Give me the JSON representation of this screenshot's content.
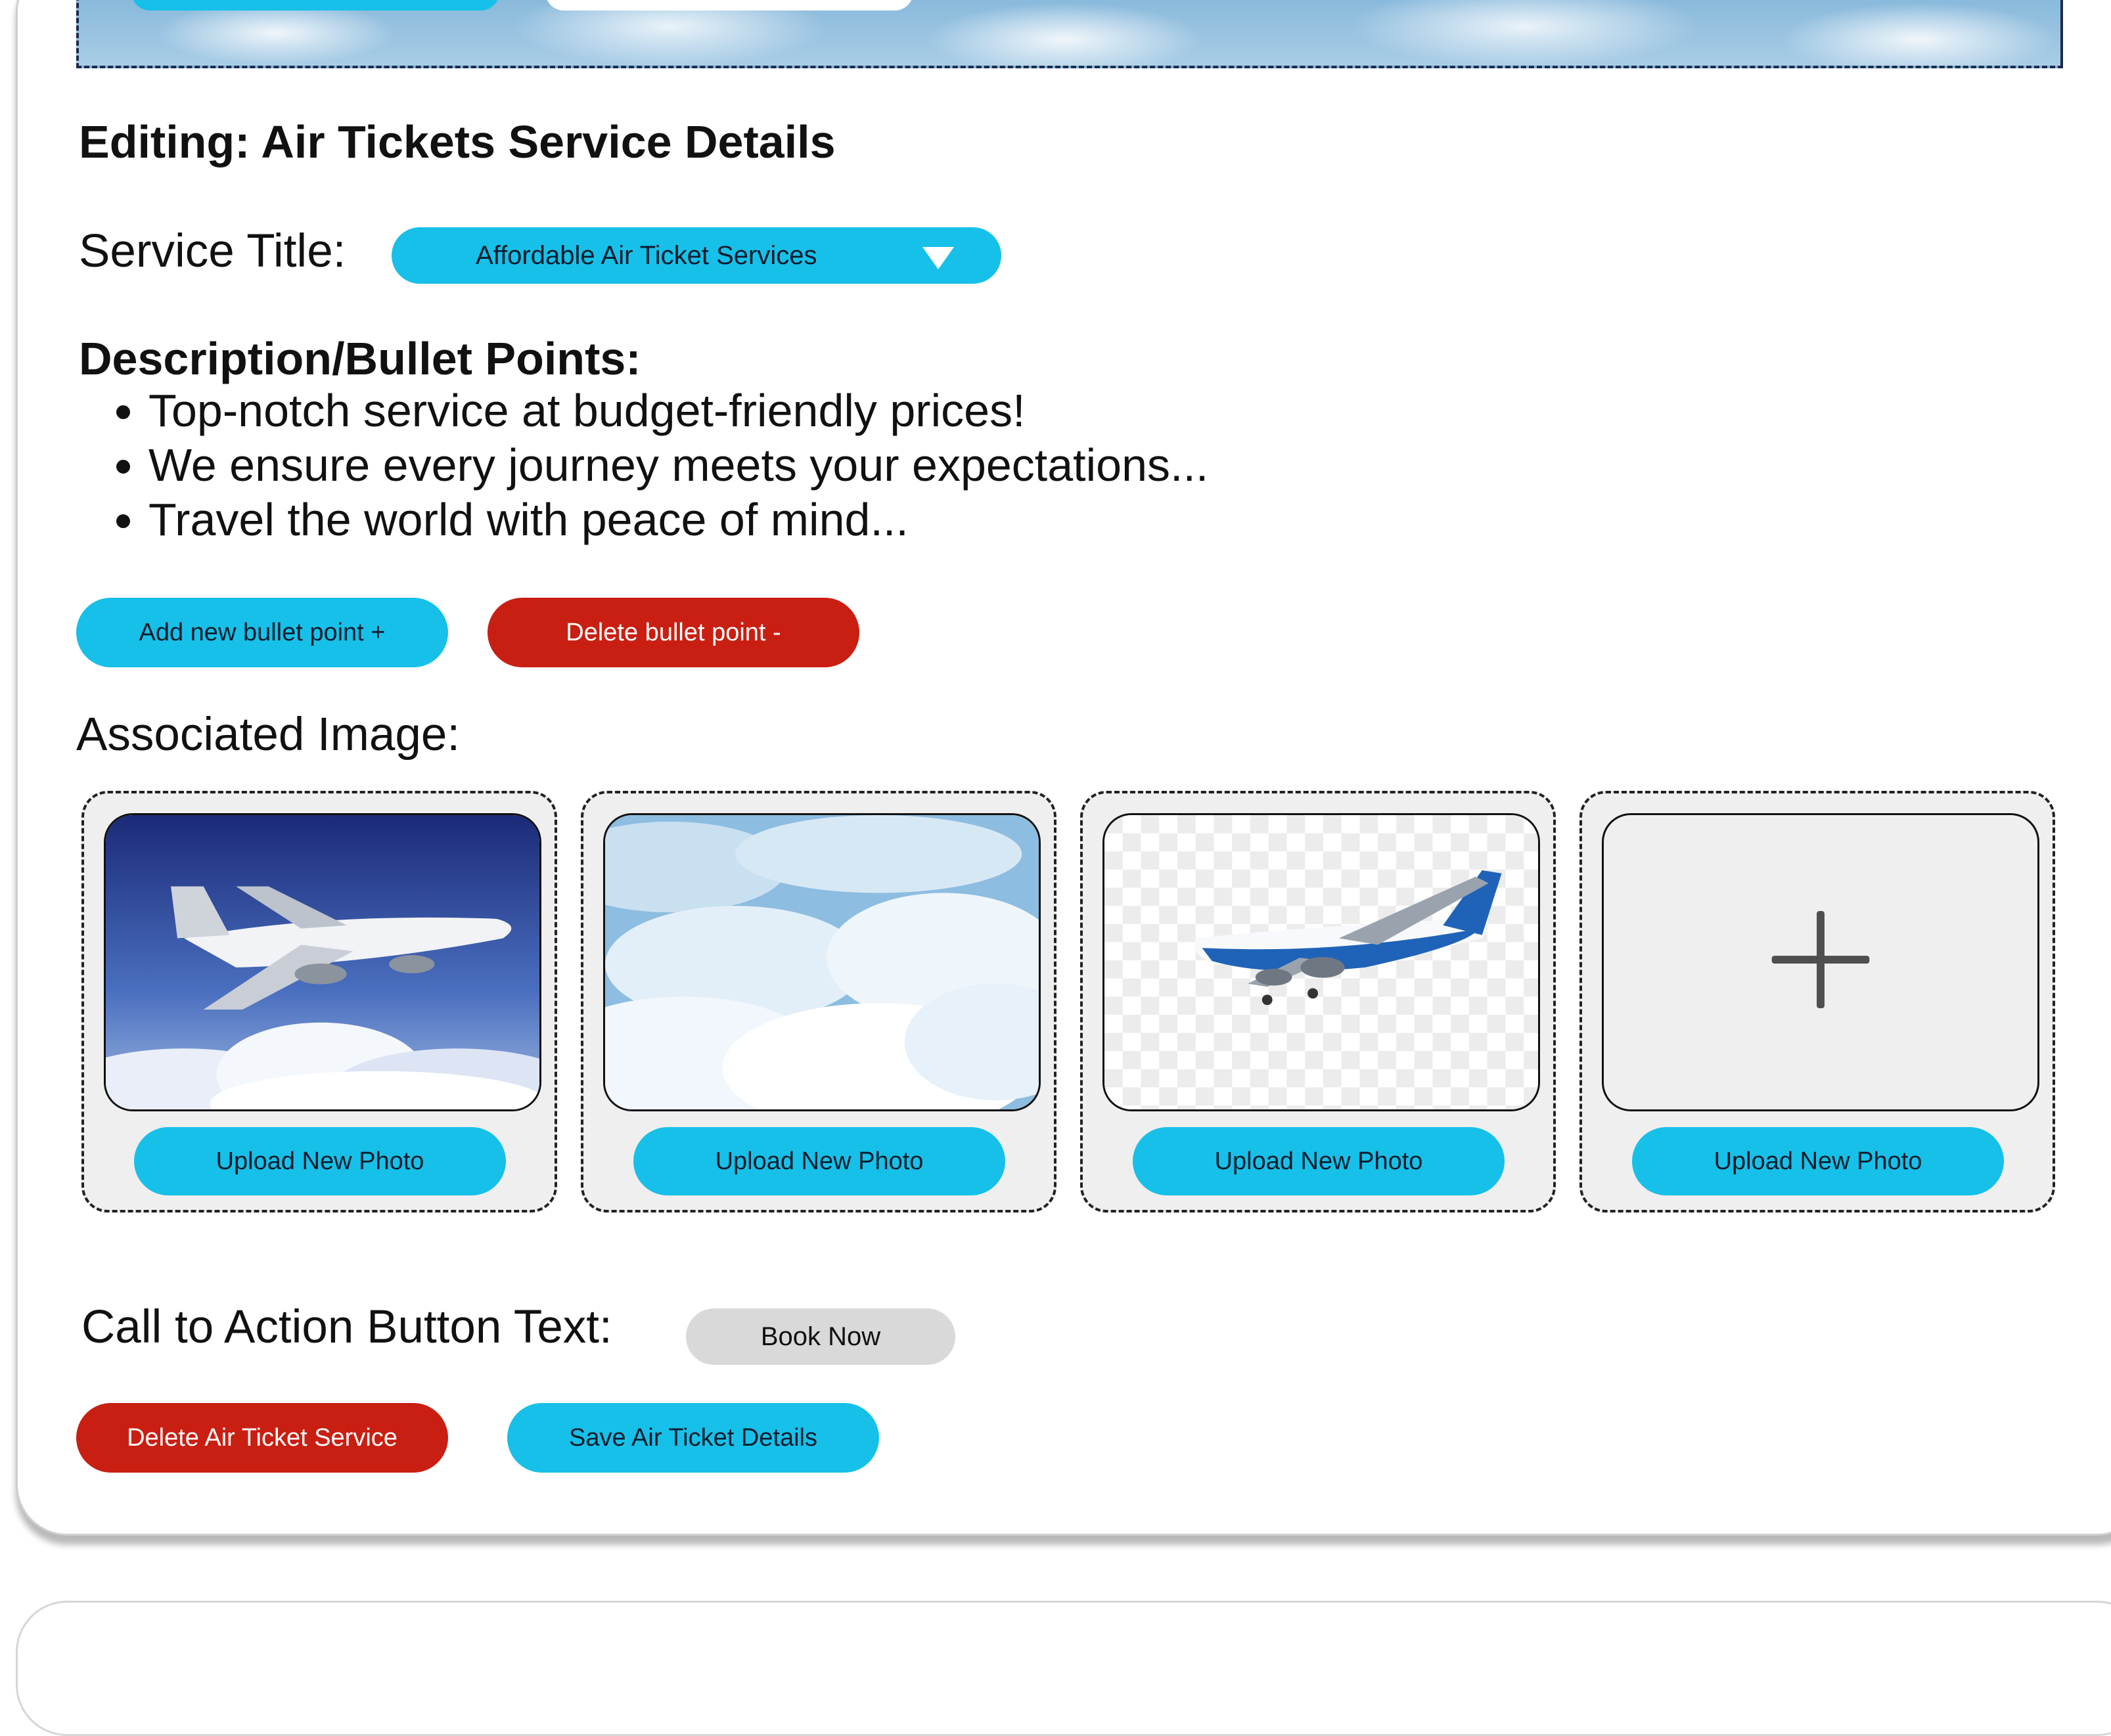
{
  "page": {
    "heading": "Editing: Air Tickets Service Details"
  },
  "service_title": {
    "label": "Service Title:",
    "selected": "Affordable Air Ticket Services"
  },
  "description": {
    "label": "Description/Bullet Points:",
    "bullets": [
      "Top-notch service at budget-friendly prices!",
      "We ensure every journey meets your expectations...",
      "Travel the world with peace of mind..."
    ],
    "add_label": "Add new bullet point +",
    "delete_label": "Delete bullet point -"
  },
  "images": {
    "label": "Associated Image:",
    "slots": [
      {
        "thumb": "airplane-over-clouds-image",
        "upload_label": "Upload New Photo"
      },
      {
        "thumb": "clouds-image",
        "upload_label": "Upload New Photo"
      },
      {
        "thumb": "airplane-transparent-image",
        "upload_label": "Upload New Photo"
      },
      {
        "thumb": "add-image-placeholder",
        "upload_label": "Upload New Photo"
      }
    ]
  },
  "cta": {
    "label": "Call to Action Button Text:",
    "value": "Book Now"
  },
  "actions": {
    "delete_label": "Delete Air Ticket Service",
    "save_label": "Save Air Ticket Details"
  },
  "colors": {
    "primary": "#17c0e8",
    "danger": "#c91f12",
    "neutral": "#d9d9d9"
  }
}
